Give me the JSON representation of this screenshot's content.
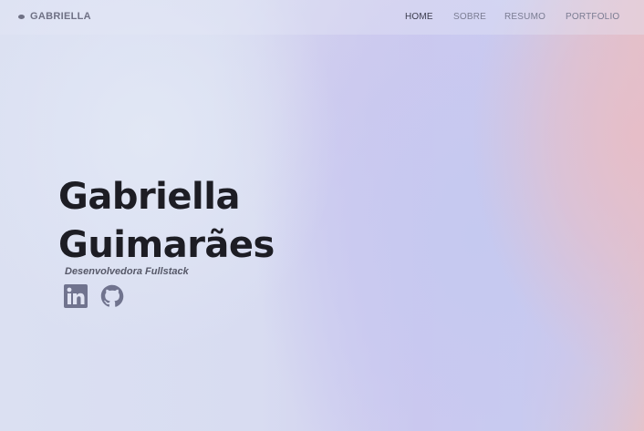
{
  "brand": {
    "name": "GABRIELLA"
  },
  "nav": {
    "items": [
      {
        "label": "HOME",
        "active": true
      },
      {
        "label": "SOBRE",
        "active": false
      },
      {
        "label": "RESUMO",
        "active": false
      },
      {
        "label": "PORTFOLIO",
        "active": false
      }
    ]
  },
  "hero": {
    "first_name": "Gabriella",
    "last_name": "Guimarães",
    "subtitle": "Desenvolvedora Fullstack"
  },
  "socials": [
    {
      "icon": "linkedin-icon"
    },
    {
      "icon": "github-icon"
    }
  ],
  "colors": {
    "text_dark": "#1d1d24",
    "nav_text": "#7a7c92",
    "icon": "#70738e",
    "accent_pink": "#e3c3cb",
    "accent_lavender": "#c8cdf0"
  }
}
